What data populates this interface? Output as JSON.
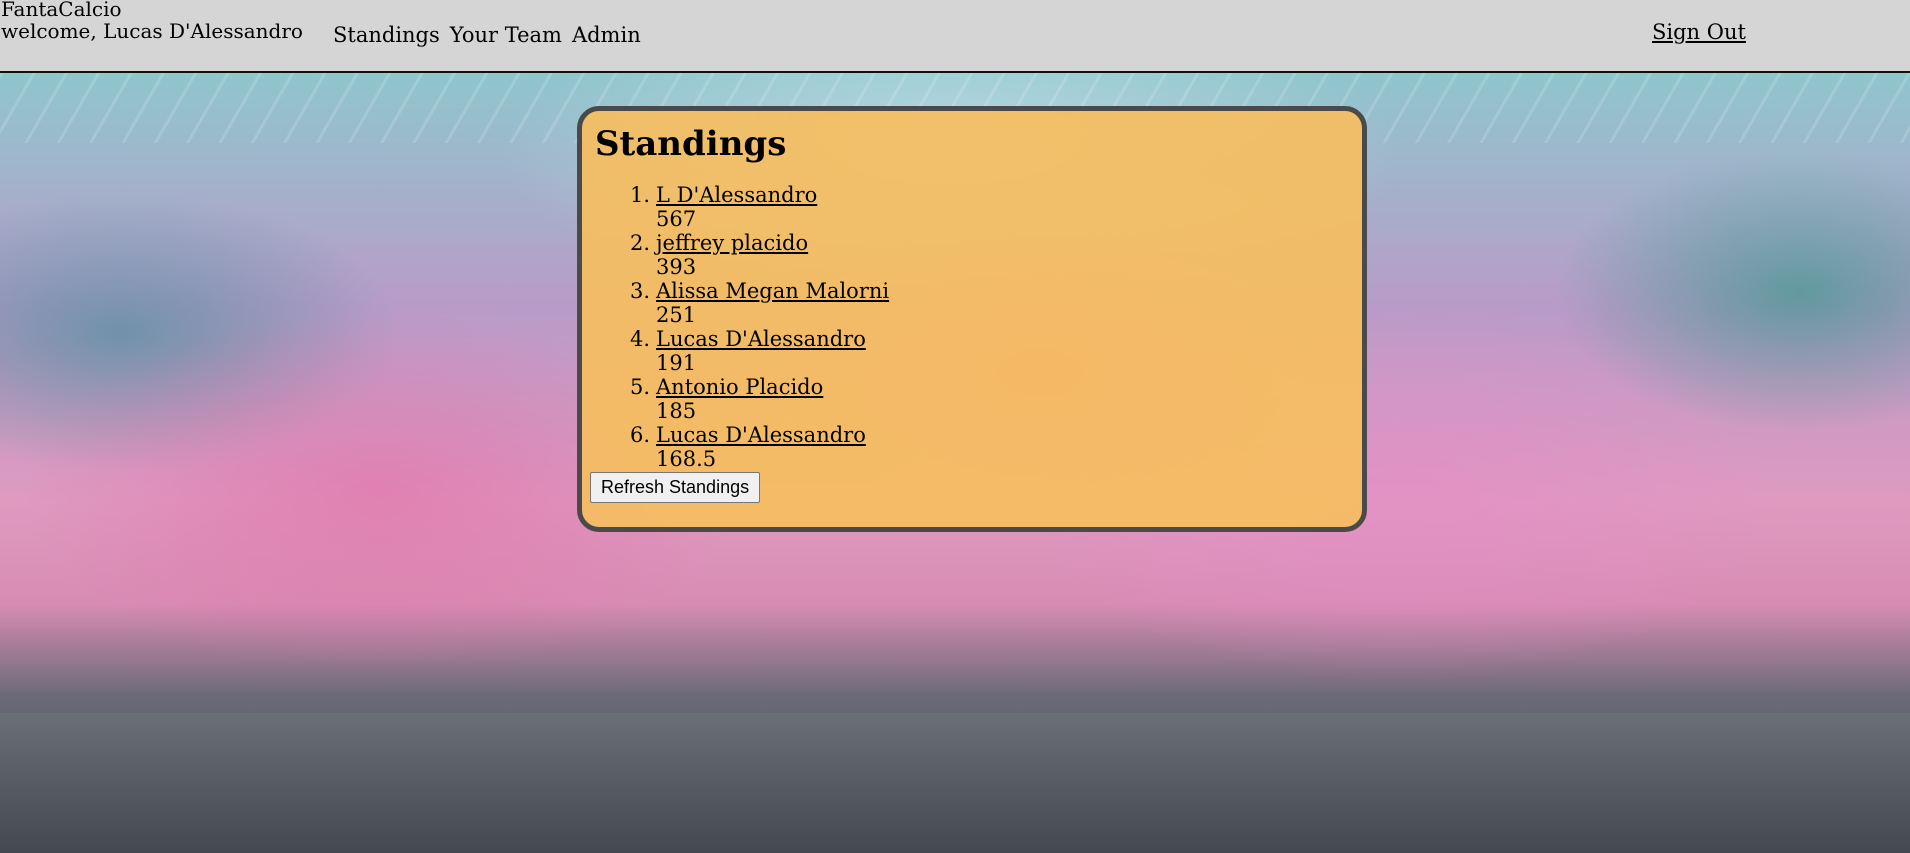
{
  "header": {
    "brand": "FantaCalcio",
    "welcome": "welcome, Lucas D'Alessandro",
    "nav": [
      {
        "label": "Standings"
      },
      {
        "label": "Your Team"
      },
      {
        "label": "Admin"
      }
    ],
    "sign_out": "Sign Out"
  },
  "standings": {
    "title": "Standings",
    "entries": [
      {
        "rank": "1.",
        "name": "L D'Alessandro",
        "score": "567"
      },
      {
        "rank": "2.",
        "name": "jeffrey placido",
        "score": "393"
      },
      {
        "rank": "3.",
        "name": "Alissa Megan Malorni",
        "score": "251"
      },
      {
        "rank": "4.",
        "name": "Lucas D'Alessandro",
        "score": "191"
      },
      {
        "rank": "5.",
        "name": "Antonio Placido",
        "score": "185"
      },
      {
        "rank": "6.",
        "name": "Lucas D'Alessandro",
        "score": "168.5"
      }
    ],
    "refresh_label": "Refresh Standings"
  },
  "colors": {
    "navbar": "#d5d5d5",
    "panel": "#f6be5f",
    "panel_border": "#4a4a4a"
  }
}
